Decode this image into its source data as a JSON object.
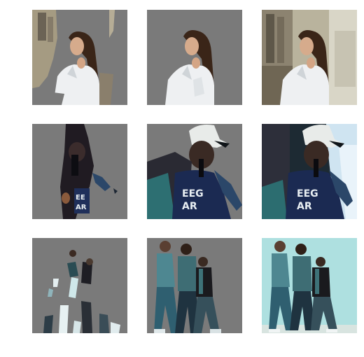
{
  "figure": {
    "rows": [
      {
        "subject": "woman in white shirt by a building",
        "tiles": [
          {
            "variant": "masked-sparse"
          },
          {
            "variant": "masked-subject"
          },
          {
            "variant": "full-image"
          }
        ]
      },
      {
        "subject": "man in white cap singing into microphone",
        "tiles": [
          {
            "variant": "masked-sparse"
          },
          {
            "variant": "masked-subject"
          },
          {
            "variant": "full-image"
          }
        ]
      },
      {
        "subject": "three men standing against the sky",
        "tiles": [
          {
            "variant": "masked-sparse"
          },
          {
            "variant": "masked-subject"
          },
          {
            "variant": "full-image"
          }
        ]
      }
    ],
    "colors": {
      "mask_gray": "#7a7a7a",
      "background": "#ffffff",
      "sky": "#aee0e0",
      "shirt_white": "#eef0f2",
      "denim": "#3d6f78"
    }
  }
}
